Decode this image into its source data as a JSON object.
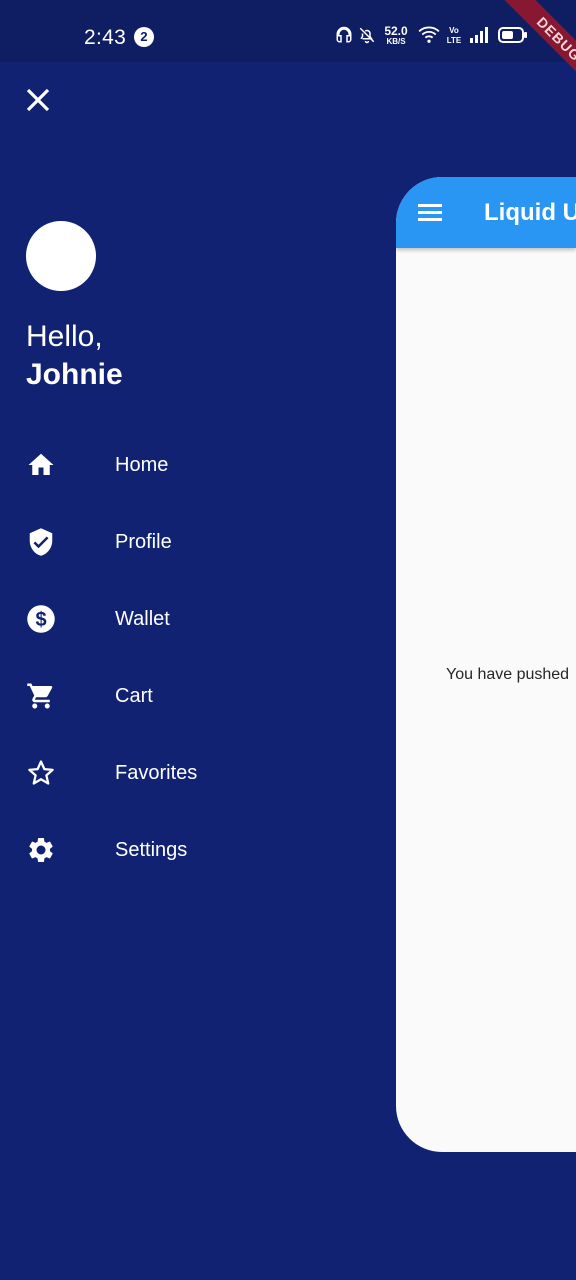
{
  "status_bar": {
    "time": "2:43",
    "notification_count": "2",
    "network_speed_value": "52.0",
    "network_speed_unit": "KB/S",
    "volte_line1": "Vo",
    "volte_line2": "LTE",
    "debug_label": "DEBUG",
    "icons": [
      "headset-icon",
      "bell-off-icon",
      "wifi-icon",
      "signal-icon",
      "battery-icon"
    ]
  },
  "drawer": {
    "greeting": "Hello,",
    "username": "Johnie",
    "menu": [
      {
        "label": "Home",
        "icon": "home-icon"
      },
      {
        "label": "Profile",
        "icon": "verified-shield-icon"
      },
      {
        "label": "Wallet",
        "icon": "dollar-coin-icon"
      },
      {
        "label": "Cart",
        "icon": "cart-icon"
      },
      {
        "label": "Favorites",
        "icon": "star-outline-icon"
      },
      {
        "label": "Settings",
        "icon": "gear-icon"
      }
    ]
  },
  "app": {
    "title": "Liquid Ui",
    "body_text": "You have pushed"
  },
  "colors": {
    "drawer_background": "#122272",
    "status_bar": "#0f1d63",
    "app_bar": "#2a96f3",
    "card_background": "#fafafa",
    "debug_ribbon": "#9e1829"
  }
}
